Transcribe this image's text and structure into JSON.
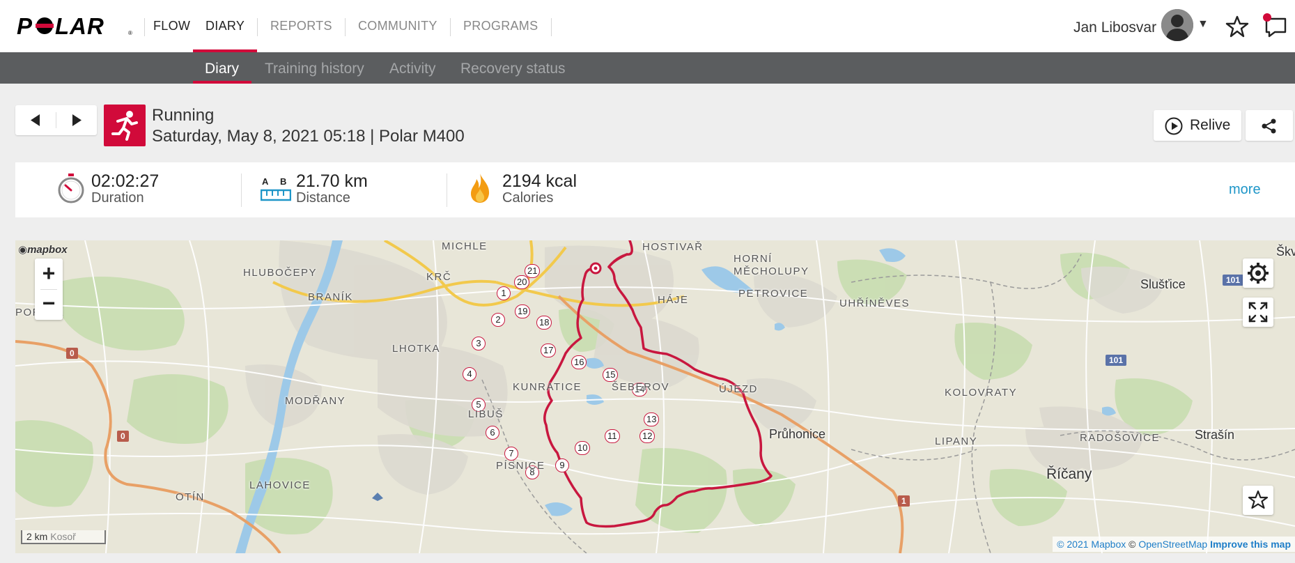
{
  "header": {
    "brand": "POLAR",
    "nav": [
      "FLOW",
      "DIARY",
      "REPORTS",
      "COMMUNITY",
      "PROGRAMS"
    ],
    "active_nav": "DIARY",
    "user_name": "Jan Libosvar"
  },
  "subnav": {
    "items": [
      "Diary",
      "Training history",
      "Activity",
      "Recovery status"
    ],
    "active": "Diary"
  },
  "session": {
    "sport": "Running",
    "meta": "Saturday, May 8, 2021 05:18 | Polar M400",
    "relive_label": "Relive"
  },
  "summary": {
    "duration": {
      "value": "02:02:27",
      "label": "Duration"
    },
    "distance": {
      "value": "21.70 km",
      "label": "Distance",
      "icon_letters": [
        "A",
        "B"
      ]
    },
    "calories": {
      "value": "2194 kcal",
      "label": "Calories"
    },
    "more_label": "more"
  },
  "map": {
    "logo": "mapbox",
    "scale_label": "2 km",
    "scale_place": "Kosoř",
    "attribution": {
      "a": "© 2021 Mapbox",
      "b": "© OpenStreetMap",
      "c": "Improve this map"
    },
    "places": [
      "HLUBOČEPY",
      "MICHLE",
      "KRČ",
      "HOSTIVAŘ",
      "HORNÍ MĚCHOLUPY",
      "BRANÍK",
      "HÁJE",
      "PETROVICE",
      "UHŘÍNĚVES",
      "LHOTKA",
      "KUNRATICE",
      "ŠEBEROV",
      "ÚJEZD",
      "MODŘANY",
      "LIBUŠ",
      "KOLOVRATY",
      "LIPANY",
      "RADOŠOVICE",
      "PÍSNICE",
      "LAHOVICE",
      "OTÍN",
      "PORTSE"
    ],
    "cities": [
      "Slušťice",
      "Průhonice",
      "Strašín",
      "Říčany",
      "Škv"
    ],
    "road_shields": [
      "0",
      "0",
      "101",
      "101",
      "1"
    ],
    "laps": [
      "1",
      "2",
      "3",
      "4",
      "5",
      "6",
      "7",
      "8",
      "9",
      "10",
      "11",
      "12",
      "13",
      "14",
      "15",
      "16",
      "17",
      "18",
      "19",
      "20",
      "21"
    ]
  },
  "colors": {
    "brand": "#d10a3a",
    "route": "#c8173f",
    "link": "#1e96c8"
  },
  "icons": [
    "prev-arrow-icon",
    "next-arrow-icon",
    "running-icon",
    "play-circle-icon",
    "share-icon",
    "stopwatch-icon",
    "distance-ruler-icon",
    "flame-icon",
    "gear-icon",
    "fullscreen-icon",
    "star-icon",
    "notification-icon",
    "avatar-icon"
  ]
}
